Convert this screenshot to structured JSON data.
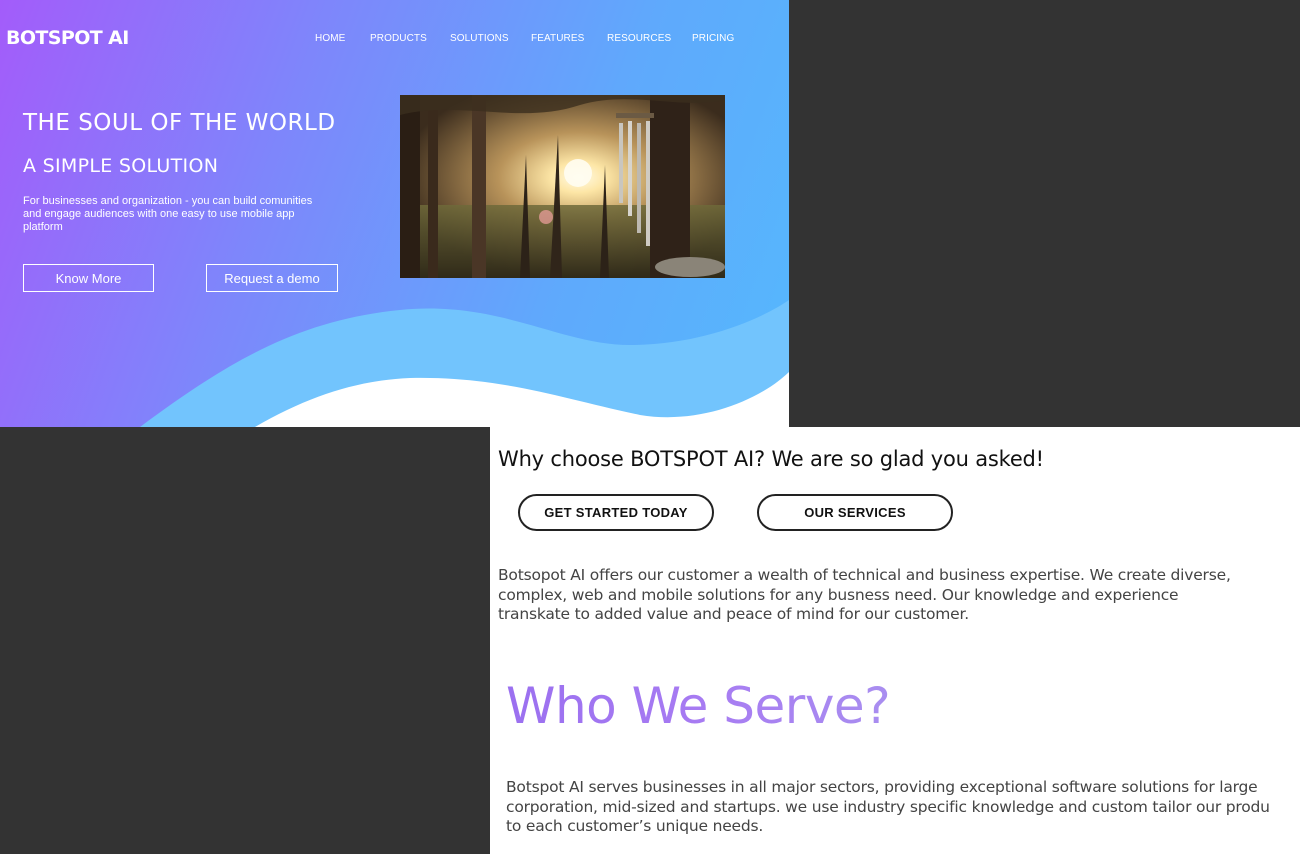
{
  "brand": {
    "logo": "BOTSPOT AI"
  },
  "nav": {
    "items": [
      "HOME",
      "PRODUCTS",
      "SOLUTIONS",
      "FEATURES",
      "RESOURCES",
      "PRICING"
    ]
  },
  "hero": {
    "title": "THE SOUL OF THE WORLD",
    "subtitle": "A SIMPLE SOLUTION",
    "description_lines": [
      "For businesses and organization - you can build comunities",
      "and engage audiences with one easy to use mobile app",
      "platform"
    ],
    "primary_button": "Know More",
    "secondary_button": "Request a demo",
    "image_icon": "sunset-wind-chime-photo"
  },
  "why": {
    "heading": "Why choose BOTSPOT AI? We are so glad you asked!",
    "get_started_button": "GET STARTED TODAY",
    "services_button": "OUR SERVICES",
    "paragraph_lines": [
      "Botsopot AI offers our customer a wealth of technical and business expertise. We create diverse,",
      "complex, web and mobile solutions for any busness need. Our knowledge and experience",
      "transkate to added value and peace of mind for our customer."
    ]
  },
  "serve": {
    "heading": "Who We Serve?",
    "paragraph_lines": [
      "Botspot AI serves businesses in all major sectors, providing exceptional software solutions for large",
      "corporation, mid-sized and startups. we use industry specific knowledge and custom tailor our produ",
      "to each customer’s unique needs."
    ]
  },
  "colors": {
    "gradient_start": "#a35cfa",
    "gradient_end": "#55b8fd",
    "wave_light": "#72c4fd",
    "background_dark": "#333333",
    "title_gradient": "#9b70f0"
  }
}
